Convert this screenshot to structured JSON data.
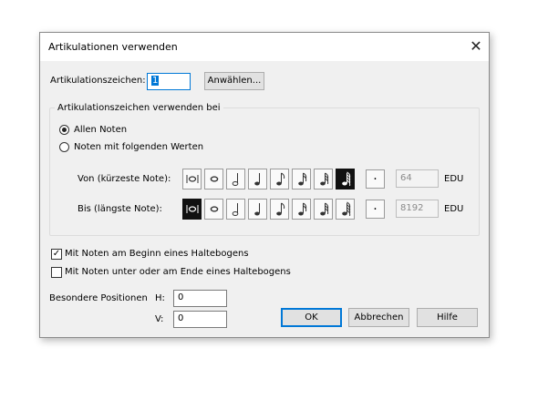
{
  "dialog": {
    "title": "Artikulationen verwenden",
    "close_glyph": "✕"
  },
  "articulation": {
    "label": "Artikulationszeichen:",
    "value": "1",
    "select_button": "Anwählen..."
  },
  "group": {
    "label": "Artikulationszeichen verwenden bei",
    "radio_all": "Allen Noten",
    "radio_values": "Noten mit folgenden Werten",
    "selected": "all"
  },
  "from_row": {
    "label": "Von (kürzeste Note):",
    "value": "64",
    "unit": "EDU",
    "selected_index": 7
  },
  "to_row": {
    "label": "Bis (längste Note):",
    "value": "8192",
    "unit": "EDU",
    "selected_index": 0
  },
  "note_buttons": [
    "breve-icon",
    "whole-note-icon",
    "half-note-icon",
    "quarter-note-icon",
    "eighth-note-icon",
    "sixteenth-note-icon",
    "thirtysecond-note-icon",
    "sixtyfourth-note-icon"
  ],
  "dot_glyph": "·",
  "checkboxes": {
    "tie_start": {
      "label": "Mit Noten am Beginn eines Haltebogens",
      "checked": true
    },
    "tie_end": {
      "label": "Mit Noten unter oder am Ende eines Haltebogens",
      "checked": false
    }
  },
  "positions": {
    "label": "Besondere Positionen",
    "h_label": "H:",
    "h_value": "0",
    "v_label": "V:",
    "v_value": "0"
  },
  "buttons": {
    "ok": "OK",
    "cancel": "Abbrechen",
    "help": "Hilfe"
  },
  "colors": {
    "accent": "#0078d7",
    "selected_note_bg": "#111111",
    "selection_highlight": "#0078d7"
  }
}
